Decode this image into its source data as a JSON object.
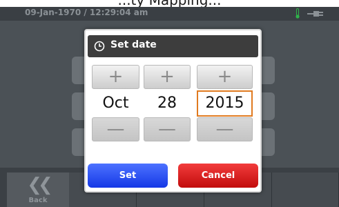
{
  "top_title": "...ty Mapping...",
  "status_bar": {
    "datetime": "09-Jan-1970 / 12:29:04 am"
  },
  "bottom_bar": {
    "back_label": "Back"
  },
  "dialog": {
    "title": "Set date",
    "spinners": [
      {
        "name": "month",
        "value": "Oct",
        "plus": "+",
        "minus": "—"
      },
      {
        "name": "day",
        "value": "28",
        "plus": "+",
        "minus": "—"
      },
      {
        "name": "year",
        "value": "2015",
        "plus": "+",
        "minus": "—"
      }
    ],
    "set_label": "Set",
    "cancel_label": "Cancel"
  },
  "colors": {
    "accent_set": "#1e46f0",
    "accent_cancel": "#d01818",
    "selection": "#e07a1f"
  }
}
